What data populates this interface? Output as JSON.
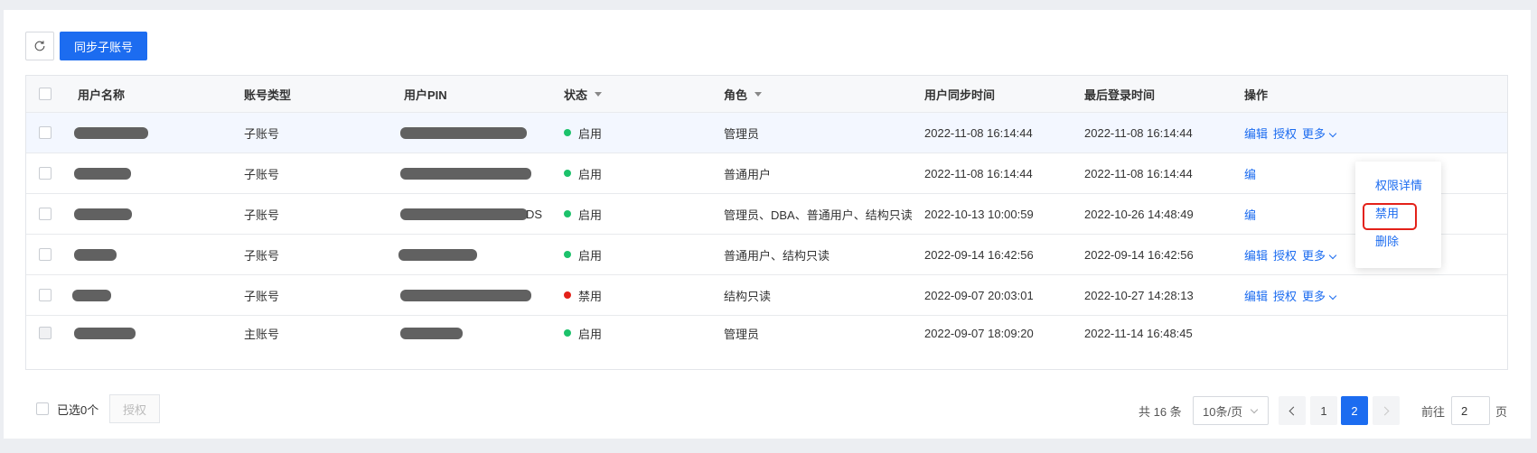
{
  "toolbar": {
    "refresh_icon": "refresh-icon",
    "sync_label": "同步子账号"
  },
  "table": {
    "columns": [
      "用户名称",
      "账号类型",
      "用户PIN",
      "状态",
      "角色",
      "用户同步时间",
      "最后登录时间",
      "操作"
    ],
    "rows": [
      {
        "type": "子账号",
        "status": "启用",
        "status_color": "#1cc26b",
        "role": "管理员",
        "sync_time": "2022-11-08 16:14:44",
        "login_time": "2022-11-08 16:14:44",
        "actions": [
          "编辑",
          "授权",
          "更多"
        ]
      },
      {
        "type": "子账号",
        "status": "启用",
        "status_color": "#1cc26b",
        "role": "普通用户",
        "sync_time": "2022-11-08 16:14:44",
        "login_time": "2022-11-08 16:14:44",
        "actions": [
          "编"
        ]
      },
      {
        "type": "子账号",
        "pin_suffix": "DS",
        "status": "启用",
        "status_color": "#1cc26b",
        "role": "管理员、DBA、普通用户、结构只读",
        "sync_time": "2022-10-13 10:00:59",
        "login_time": "2022-10-26 14:48:49",
        "actions": [
          "编"
        ]
      },
      {
        "type": "子账号",
        "status": "启用",
        "status_color": "#1cc26b",
        "role": "普通用户、结构只读",
        "sync_time": "2022-09-14 16:42:56",
        "login_time": "2022-09-14 16:42:56",
        "actions": [
          "编辑",
          "授权",
          "更多"
        ]
      },
      {
        "type": "子账号",
        "status": "禁用",
        "status_color": "#e32119",
        "role": "结构只读",
        "sync_time": "2022-09-07 20:03:01",
        "login_time": "2022-10-27 14:28:13",
        "actions": [
          "编辑",
          "授权",
          "更多"
        ]
      },
      {
        "type": "主账号",
        "status": "启用",
        "status_color": "#1cc26b",
        "role": "管理员",
        "sync_time": "2022-09-07 18:09:20",
        "login_time": "2022-11-14 16:48:45",
        "actions": []
      }
    ]
  },
  "dropdown": {
    "items": [
      "权限详情",
      "禁用",
      "删除"
    ]
  },
  "footer": {
    "selected_label": "已选0个",
    "authorize_label": "授权",
    "total_label": "共 16 条",
    "page_size": "10条/页",
    "pages": [
      "1",
      "2"
    ],
    "current_page": "2",
    "jump_prefix": "前往",
    "jump_value": "2",
    "jump_suffix": "页"
  },
  "colors": {
    "primary": "#1c6cf0",
    "enabled": "#1cc26b",
    "disabled": "#e32119",
    "highlight_box": "#e32119"
  }
}
